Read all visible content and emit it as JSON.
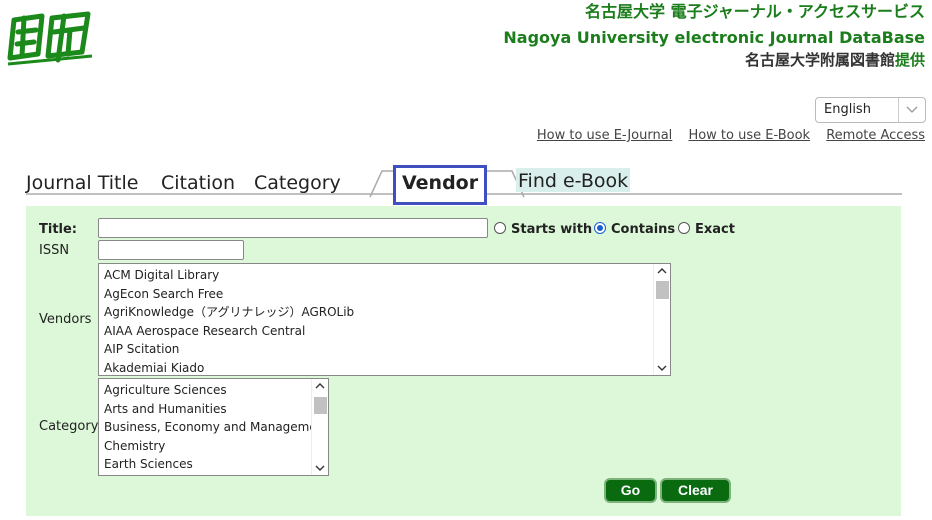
{
  "header": {
    "title_jp": "名古屋大学 電子ジャーナル・アクセスサービス",
    "title_en": "Nagoya University electronic Journal DataBase",
    "provider_prefix": "名古屋大学附属図書館",
    "provider_accent": "提供"
  },
  "language": {
    "selected": "English"
  },
  "help_links": [
    "How to use E-Journal",
    "How to use E-Book",
    "Remote Access"
  ],
  "tabs": {
    "journal_title": "Journal Title",
    "citation": "Citation",
    "category": "Category",
    "vendor": "Vendor",
    "find_ebook": "Find e-Book"
  },
  "form": {
    "title_label": "Title:",
    "title_value": "",
    "issn_label": "ISSN",
    "issn_value": "",
    "match_options": [
      "Starts with",
      "Contains",
      "Exact"
    ],
    "match_selected": "Contains",
    "vendors_label": "Vendors",
    "vendors": [
      "ACM Digital Library",
      "AgEcon Search Free",
      "AgriKnowledge（アグリナレッジ）AGROLib",
      "AIAA Aerospace Research Central",
      "AIP Scitation",
      "Akademiai Kiado"
    ],
    "category_label": "Category",
    "categories": [
      "Agriculture Sciences",
      "Arts and Humanities",
      "Business, Economy and Management",
      "Chemistry",
      "Earth Sciences"
    ],
    "go_label": "Go",
    "clear_label": "Clear"
  },
  "colors": {
    "brand_green": "#1b7d1b",
    "panel_bg": "#dcf8d8",
    "button_green": "#0a6a10",
    "highlight_border": "#3f4fc0",
    "ebook_tab_bg": "#d9efec"
  },
  "icons": {
    "logo": "nagoya-university-logo-icon",
    "dropdown": "chevron-down-icon"
  }
}
